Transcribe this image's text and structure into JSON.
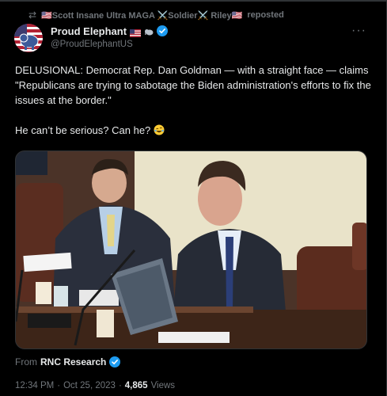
{
  "repost": {
    "reposter_name": "🇺🇸Scott Insane Ultra MAGA ⚔️Soldier⚔️ Riley🇺🇸",
    "action": "reposted",
    "icon": "repost-icon"
  },
  "author": {
    "display_name": "Proud Elephant",
    "handle": "@ProudElephantUS",
    "verified": true,
    "avatar_icon": "elephant-flag-avatar"
  },
  "tweet": {
    "paragraph_1": "DELUSIONAL: Democrat Rep. Dan Goldman — with a straight face — claims \"Republicans are trying to sabotage the Biden administration's efforts to fix the issues at the border.\"",
    "paragraph_2": "He can’t be serious? Can he?",
    "emoji": "rolling-on-floor-laughing-emoji"
  },
  "media": {
    "type": "video-still",
    "description_icon": "hearing-room-video"
  },
  "attribution": {
    "prefix": "From",
    "source": "RNC Research",
    "verified": true
  },
  "meta": {
    "time": "12:34 PM",
    "separator": "·",
    "date": "Oct 25, 2023",
    "views_count": "4,865",
    "views_label": "Views"
  },
  "colors": {
    "background": "#000000",
    "text_primary": "#e7e9ea",
    "text_secondary": "#71767b",
    "verified_blue": "#1d9bf0",
    "border": "#2f3336"
  }
}
